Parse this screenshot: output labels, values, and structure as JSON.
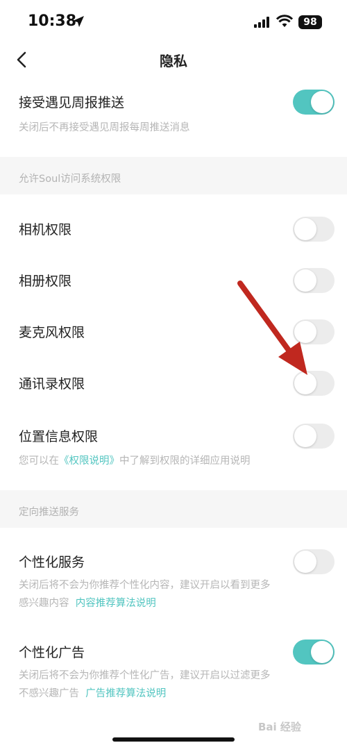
{
  "status_bar": {
    "time": "10:38",
    "battery": "98"
  },
  "nav": {
    "title": "隐私"
  },
  "weekly_report": {
    "label": "接受遇见周报推送",
    "desc": "关闭后不再接受遇见周报每周推送消息",
    "enabled": true
  },
  "permissions_section": {
    "header": "允许Soul访问系统权限",
    "items": [
      {
        "label": "相机权限",
        "enabled": false
      },
      {
        "label": "相册权限",
        "enabled": false
      },
      {
        "label": "麦克风权限",
        "enabled": false
      },
      {
        "label": "通讯录权限",
        "enabled": false
      },
      {
        "label": "位置信息权限",
        "enabled": false
      }
    ],
    "note_prefix": "您可以在",
    "note_link": "《权限说明》",
    "note_suffix": "中了解到权限的详细应用说明"
  },
  "push_section": {
    "header": "定向推送服务",
    "personalized_service": {
      "label": "个性化服务",
      "enabled": false,
      "desc_line1": "关闭后将不会为你推荐个性化内容，建议开启以看到更多",
      "desc_line2": "感兴趣内容",
      "link": "内容推荐算法说明"
    },
    "personalized_ads": {
      "label": "个性化广告",
      "enabled": true,
      "desc_line1": "关闭后将不会为你推荐个性化广告，建议开启以过滤更多",
      "desc_line2": "不感兴趣广告",
      "link": "广告推荐算法说明"
    }
  },
  "watermark": "Bai 经验",
  "colors": {
    "accent": "#52c5c0",
    "toggle_off": "#ececec",
    "annotation_arrow": "#c0281f"
  }
}
